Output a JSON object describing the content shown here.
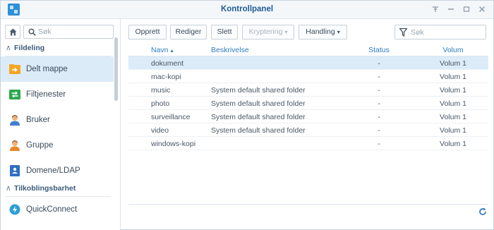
{
  "window": {
    "title": "Kontrollpanel"
  },
  "sidebar": {
    "search_placeholder": "Søk",
    "groups": [
      {
        "label": "Fildeling"
      },
      {
        "label": "Tilkoblingsbarhet"
      }
    ],
    "items": [
      {
        "label": "Delt mappe",
        "icon": "shared-folder-icon",
        "active": true
      },
      {
        "label": "Filtjenester",
        "icon": "file-services-icon"
      },
      {
        "label": "Bruker",
        "icon": "user-icon"
      },
      {
        "label": "Gruppe",
        "icon": "group-icon"
      },
      {
        "label": "Domene/LDAP",
        "icon": "domain-ldap-icon"
      },
      {
        "label": "QuickConnect",
        "icon": "quickconnect-icon"
      }
    ]
  },
  "toolbar": {
    "create": "Opprett",
    "edit": "Rediger",
    "delete": "Slett",
    "encryption": "Kryptering",
    "action": "Handling",
    "filter_placeholder": "Søk"
  },
  "table": {
    "columns": {
      "name": "Navn",
      "description": "Beskrivelse",
      "status": "Status",
      "volume": "Volum"
    },
    "sort_indicator": "▴",
    "rows": [
      {
        "name": "dokument",
        "description": "",
        "status": "-",
        "volume": "Volum 1",
        "selected": true
      },
      {
        "name": "mac-kopi",
        "description": "",
        "status": "-",
        "volume": "Volum 1"
      },
      {
        "name": "music",
        "description": "System default shared folder",
        "status": "-",
        "volume": "Volum 1"
      },
      {
        "name": "photo",
        "description": "System default shared folder",
        "status": "-",
        "volume": "Volum 1"
      },
      {
        "name": "surveillance",
        "description": "System default shared folder",
        "status": "-",
        "volume": "Volum 1"
      },
      {
        "name": "video",
        "description": "System default shared folder",
        "status": "-",
        "volume": "Volum 1"
      },
      {
        "name": "windows-kopi",
        "description": "",
        "status": "-",
        "volume": "Volum 1"
      }
    ]
  },
  "colors": {
    "accent": "#2f7cc0",
    "selection": "#dcebf8",
    "title": "#1e5c96"
  }
}
